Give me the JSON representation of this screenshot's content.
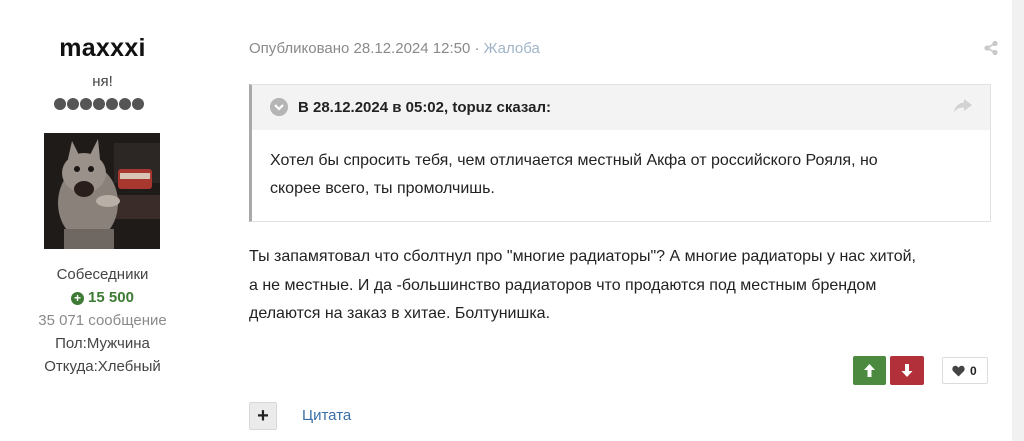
{
  "author": {
    "username": "maxxxi",
    "title": "ня!",
    "pip_count": 7,
    "group": "Собеседники",
    "reputation": "15 500",
    "post_count": "35 071 сообщение",
    "gender": "Пол:Мужчина",
    "location": "Откуда:Хлебный"
  },
  "post": {
    "published": "Опубликовано 28.12.2024 12:50",
    "separator": "·",
    "report_label": "Жалоба",
    "quote": {
      "citation": "В 28.12.2024 в 05:02, topuz сказал:",
      "text_line1": "Хотел бы спросить тебя, чем отличается местный Акфа от российского Рояля, но",
      "text_line2": "скорее всего, ты промолчишь."
    },
    "body": [
      "Ты запамятовал что сболтнул про \"многие радиаторы\"? А многие радиаторы у нас хитой,",
      "а не местные. И да -большинство радиаторов что продаются под местным брендом",
      "делаются на заказ в хитае. Болтунишка."
    ],
    "like_count": "0",
    "quote_action": "Цитата",
    "plus_symbol": "+"
  },
  "colors": {
    "vote_up": "#4c8a3f",
    "vote_down": "#b1303a",
    "reputation": "#3d7a34",
    "link": "#3b6fa7"
  },
  "icons": [
    "share-icon",
    "chevron-toggle-icon",
    "quote-jump-icon",
    "arrow-up-icon",
    "arrow-down-icon",
    "heart-icon"
  ]
}
